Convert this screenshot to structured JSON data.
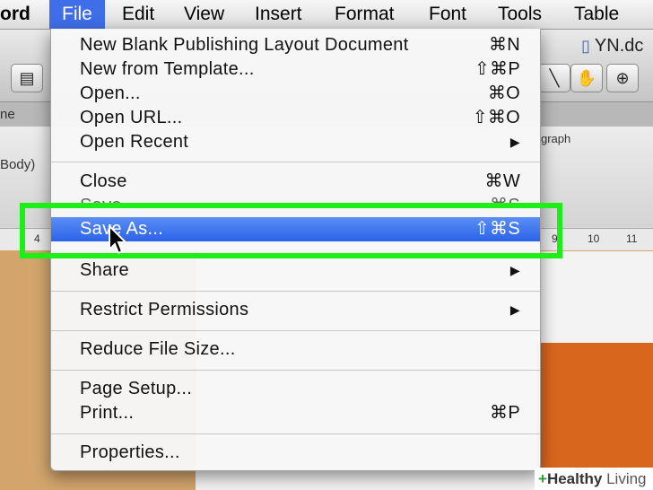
{
  "menubar": {
    "app_partial": "ord",
    "items": [
      "File",
      "Edit",
      "View",
      "Insert",
      "Format",
      "Font",
      "Tools",
      "Table"
    ]
  },
  "document": {
    "title_partial": "YN.dc"
  },
  "background": {
    "tab_partial": "ne",
    "font_box_partial": "Body)",
    "ribbon_label_partial": "graph",
    "ruler_left": "4",
    "ruler_marks": [
      "9",
      "10",
      "11"
    ]
  },
  "file_menu": {
    "items": [
      {
        "label": "New Blank Publishing Layout Document",
        "shortcut": "⌘N"
      },
      {
        "label": "New from Template...",
        "shortcut": "⇧⌘P"
      },
      {
        "label": "Open...",
        "shortcut": "⌘O"
      },
      {
        "label": "Open URL...",
        "shortcut": "⇧⌘O"
      },
      {
        "label": "Open Recent",
        "submenu": "▶"
      },
      {
        "label": "Close",
        "shortcut": "⌘W"
      },
      {
        "label": "Save",
        "shortcut": "⌘S"
      },
      {
        "label": "Save As...",
        "shortcut": "⇧⌘S"
      },
      {
        "label": "Share",
        "submenu": "▶"
      },
      {
        "label": "Restrict Permissions",
        "submenu": "▶"
      },
      {
        "label": "Reduce File Size..."
      },
      {
        "label": "Page Setup..."
      },
      {
        "label": "Print...",
        "shortcut": "⌘P"
      },
      {
        "label": "Properties..."
      }
    ],
    "selected_item": "Save As..."
  },
  "colors": {
    "highlight_box": "#1dee17",
    "selection": "#3f6ee8",
    "accent_orange": "#d9661d"
  },
  "watermark": {
    "brand_plus": "+",
    "brand_bold": "Healthy",
    "brand_rest": " Living"
  }
}
